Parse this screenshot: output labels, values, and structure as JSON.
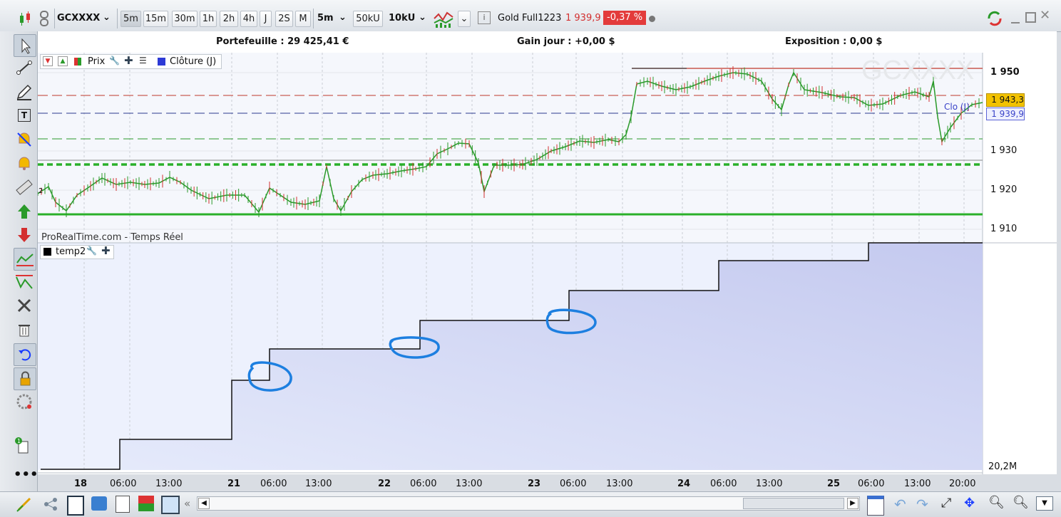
{
  "toolbar": {
    "symbol": "GCXXXX",
    "intervals": [
      "5m",
      "15m",
      "30m",
      "1h",
      "2h",
      "4h",
      "J",
      "2S",
      "M"
    ],
    "selected_interval": "5m",
    "period": "5m",
    "units": "50kU",
    "units2": "10kU",
    "instrument": "Gold Full1223",
    "last_price": "1 939,9",
    "change": "-0,37 %"
  },
  "info": {
    "portfolio": "Portefeuille : 29 425,41 €",
    "gain": "Gain jour : +0,00 $",
    "exposure": "Exposition : 0,00 $"
  },
  "price_panel": {
    "legend_prix": "Prix",
    "legend_close": "Clôture (J)",
    "watermark": "GCXXXX",
    "source": "ProRealTime.com - Temps Réel",
    "y_ticks": [
      "1 950",
      "1 930",
      "1 920",
      "1 910"
    ],
    "tag_current": "1 943,3",
    "tag_close": "1 939,9",
    "close_label": "Clo (J)",
    "left_tick": "2"
  },
  "indicator_panel": {
    "name": "temp2",
    "y_label": "20,2M"
  },
  "x_axis": {
    "labels": [
      "18",
      "06:00",
      "13:00",
      "21",
      "06:00",
      "13:00",
      "22",
      "06:00",
      "13:00",
      "23",
      "06:00",
      "13:00",
      "24",
      "06:00",
      "13:00",
      "25",
      "06:00",
      "13:00",
      "20:00"
    ]
  },
  "chart_data": {
    "type": "line",
    "x": [
      "18",
      "21",
      "22",
      "23",
      "24",
      "25"
    ],
    "ylim": [
      1910,
      1951
    ],
    "series": [],
    "horizontal_levels": [
      1951,
      1943.3,
      1939.9,
      1933,
      1928,
      1927,
      1914
    ],
    "indicator_steps": [
      1,
      2,
      3,
      4,
      5,
      6,
      7,
      8,
      9
    ]
  },
  "colors": {
    "up": "#1f9a2a",
    "down": "#d32f2f",
    "indicator_fill": "#a7b0e0",
    "annotation": "#1d7fe0",
    "price_tag": "#f2c200",
    "change_badge": "#e33b3b"
  }
}
